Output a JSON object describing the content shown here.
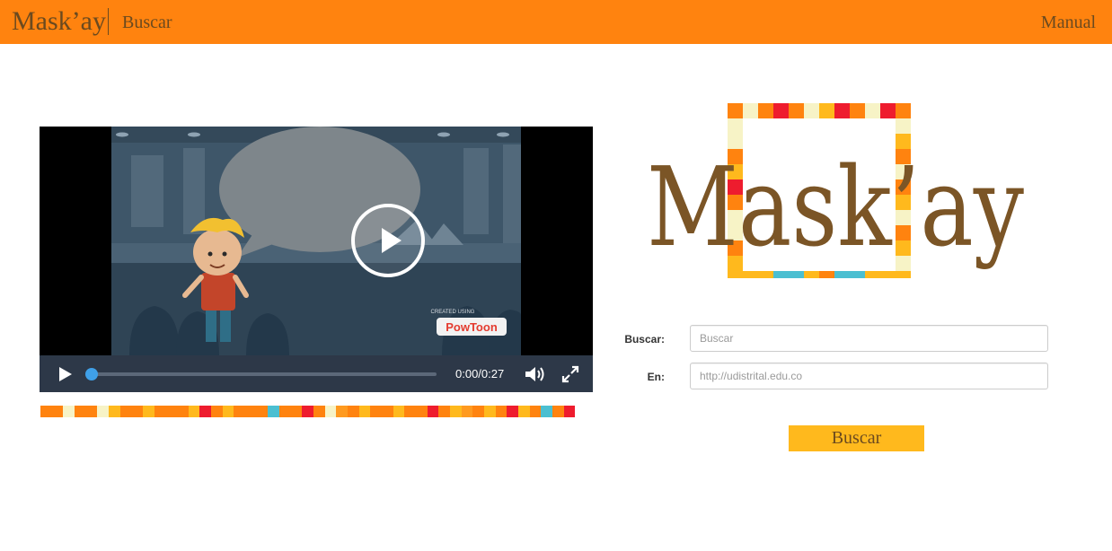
{
  "navbar": {
    "brand": "Mask’ay",
    "search_link": "Buscar",
    "manual_link": "Manual"
  },
  "video": {
    "time": "0:00/0:27",
    "progress": 0.0,
    "watermark_top": "CREATED USING",
    "watermark_brand": "PowToon"
  },
  "logo": {
    "text": "Mask’ay"
  },
  "search_form": {
    "query_label": "Buscar:",
    "query_placeholder": "Buscar",
    "site_label": "En:",
    "site_placeholder": "http://udistrital.edu.co",
    "submit_label": "Buscar"
  },
  "colors": {
    "navbar": "#ff830f",
    "brand_text": "#6b4a1f",
    "button": "#ffb91d",
    "progress": "#3fa0e8",
    "mosaic": [
      "#ff830f",
      "#ffb91d",
      "#f7f3c6",
      "#ee1c2e",
      "#4bbfd1",
      "#ff9a1f"
    ]
  }
}
